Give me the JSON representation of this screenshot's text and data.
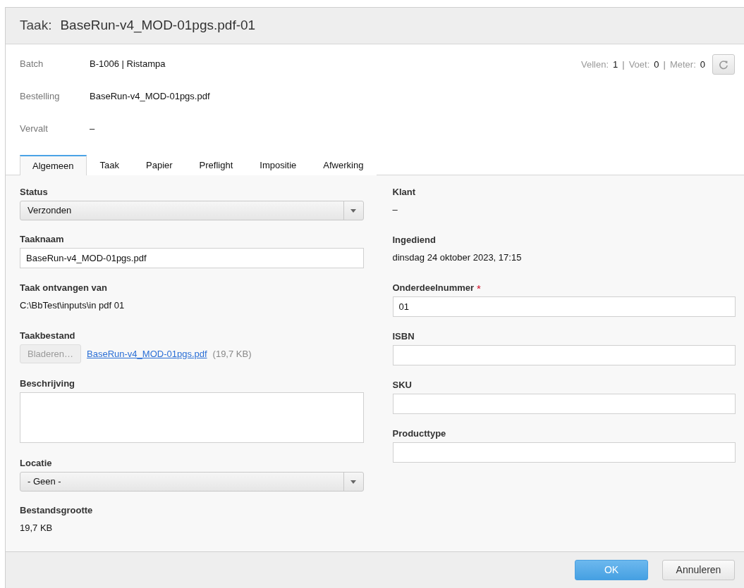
{
  "header": {
    "label": "Taak:",
    "title": "BaseRun-v4_MOD-01pgs.pdf-01"
  },
  "info": [
    {
      "label": "Batch",
      "value": "B-1006 | Ristampa"
    },
    {
      "label": "Bestelling",
      "value": "BaseRun-v4_MOD-01pgs.pdf"
    },
    {
      "label": "Vervalt",
      "value": "–"
    }
  ],
  "stats": {
    "separator": "|",
    "items": [
      {
        "label": "Vellen:",
        "value": "1"
      },
      {
        "label": "Voet:",
        "value": "0"
      },
      {
        "label": "Meter:",
        "value": "0"
      }
    ]
  },
  "tabs": [
    {
      "label": "Algemeen",
      "selected": true
    },
    {
      "label": "Taak",
      "selected": false
    },
    {
      "label": "Papier",
      "selected": false
    },
    {
      "label": "Preflight",
      "selected": false
    },
    {
      "label": "Impositie",
      "selected": false
    },
    {
      "label": "Afwerking",
      "selected": false
    }
  ],
  "required_mark": "*",
  "left_fields": [
    {
      "kind": "select",
      "label": "Status",
      "value": "Verzonden"
    },
    {
      "kind": "input",
      "label": "Taaknaam",
      "value": "BaseRun-v4_MOD-01pgs.pdf"
    },
    {
      "kind": "text",
      "label": "Taak ontvangen van",
      "value": "C:\\BbTest\\inputs\\in pdf 01"
    },
    {
      "kind": "file",
      "label": "Taakbestand",
      "button": "Bladeren…",
      "disabled": true,
      "link": "BaseRun-v4_MOD-01pgs.pdf",
      "size": "(19,7 KB)"
    },
    {
      "kind": "textarea",
      "label": "Beschrijving"
    },
    {
      "kind": "select",
      "label": "Locatie",
      "value": "- Geen -"
    },
    {
      "kind": "text",
      "label": "Bestandsgrootte",
      "value": "19,7 KB"
    }
  ],
  "right_fields": [
    {
      "kind": "text",
      "label": "Klant",
      "value": "–"
    },
    {
      "kind": "text",
      "label": "Ingediend",
      "value": "dinsdag 24 oktober 2023, 17:15"
    },
    {
      "kind": "input",
      "label": "Onderdeelnummer",
      "value": "01",
      "required": true
    },
    {
      "kind": "input",
      "label": "ISBN",
      "required": false
    },
    {
      "kind": "input",
      "label": "SKU",
      "required": false
    },
    {
      "kind": "input",
      "label": "Producttype",
      "required": false
    }
  ],
  "buttons": [
    {
      "kind": "primary",
      "label": "OK"
    },
    {
      "kind": "secondary",
      "label": "Annuleren"
    }
  ]
}
